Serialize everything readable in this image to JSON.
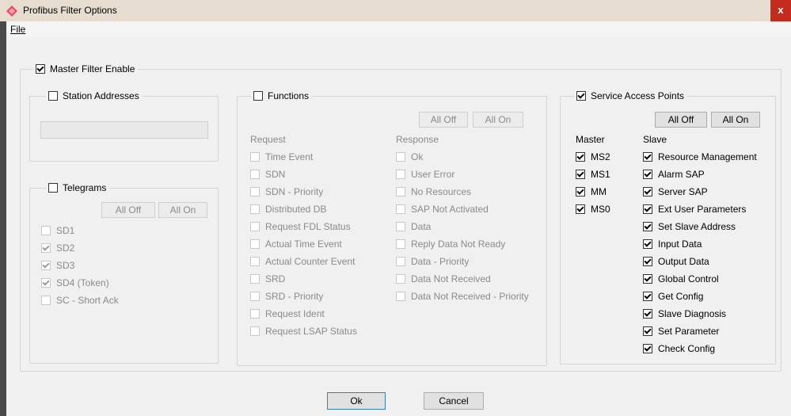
{
  "window": {
    "title": "Profibus Filter Options",
    "close_glyph": "x",
    "icon": "profibus-diamond-icon",
    "accent_color": "#e84a5f"
  },
  "menu": {
    "file_label": "File"
  },
  "master_filter": {
    "label": "Master Filter Enable",
    "checked": true
  },
  "station": {
    "label": "Station Addresses",
    "checked": false,
    "value": ""
  },
  "telegrams": {
    "label": "Telegrams",
    "checked": false,
    "all_off": "All Off",
    "all_on": "All On",
    "items": [
      {
        "label": "SD1",
        "checked": false
      },
      {
        "label": "SD2",
        "checked": true
      },
      {
        "label": "SD3",
        "checked": true
      },
      {
        "label": "SD4 (Token)",
        "checked": true
      },
      {
        "label": "SC - Short Ack",
        "checked": false
      }
    ]
  },
  "functions": {
    "label": "Functions",
    "checked": false,
    "all_off": "All Off",
    "all_on": "All On",
    "request_header": "Request",
    "response_header": "Response",
    "request": [
      {
        "label": "Time Event",
        "checked": false
      },
      {
        "label": "SDN",
        "checked": false
      },
      {
        "label": "SDN - Priority",
        "checked": false
      },
      {
        "label": "Distributed DB",
        "checked": false
      },
      {
        "label": "Request FDL Status",
        "checked": false
      },
      {
        "label": "Actual Time Event",
        "checked": false
      },
      {
        "label": "Actual Counter Event",
        "checked": false
      },
      {
        "label": "SRD",
        "checked": false
      },
      {
        "label": "SRD - Priority",
        "checked": false
      },
      {
        "label": "Request Ident",
        "checked": false
      },
      {
        "label": "Request LSAP Status",
        "checked": false
      }
    ],
    "response": [
      {
        "label": "Ok",
        "checked": false
      },
      {
        "label": "User Error",
        "checked": false
      },
      {
        "label": "No Resources",
        "checked": false
      },
      {
        "label": "SAP Not Activated",
        "checked": false
      },
      {
        "label": "Data",
        "checked": false
      },
      {
        "label": "Reply Data Not Ready",
        "checked": false
      },
      {
        "label": "Data - Priority",
        "checked": false
      },
      {
        "label": "Data Not Received",
        "checked": false
      },
      {
        "label": "Data Not Received - Priority",
        "checked": false
      }
    ]
  },
  "sap": {
    "label": "Service Access Points",
    "checked": true,
    "all_off": "All Off",
    "all_on": "All On",
    "master_header": "Master",
    "slave_header": "Slave",
    "master": [
      {
        "label": "MS2",
        "checked": true
      },
      {
        "label": "MS1",
        "checked": true
      },
      {
        "label": "MM",
        "checked": true
      },
      {
        "label": "MS0",
        "checked": true
      }
    ],
    "slave": [
      {
        "label": "Resource Management",
        "checked": true
      },
      {
        "label": "Alarm SAP",
        "checked": true
      },
      {
        "label": "Server SAP",
        "checked": true
      },
      {
        "label": "Ext User Parameters",
        "checked": true
      },
      {
        "label": "Set Slave Address",
        "checked": true
      },
      {
        "label": "Input Data",
        "checked": true
      },
      {
        "label": "Output Data",
        "checked": true
      },
      {
        "label": "Global Control",
        "checked": true
      },
      {
        "label": "Get Config",
        "checked": true
      },
      {
        "label": "Slave Diagnosis",
        "checked": true
      },
      {
        "label": "Set Parameter",
        "checked": true
      },
      {
        "label": "Check Config",
        "checked": true
      }
    ]
  },
  "footer": {
    "ok_label": "Ok",
    "cancel_label": "Cancel"
  }
}
